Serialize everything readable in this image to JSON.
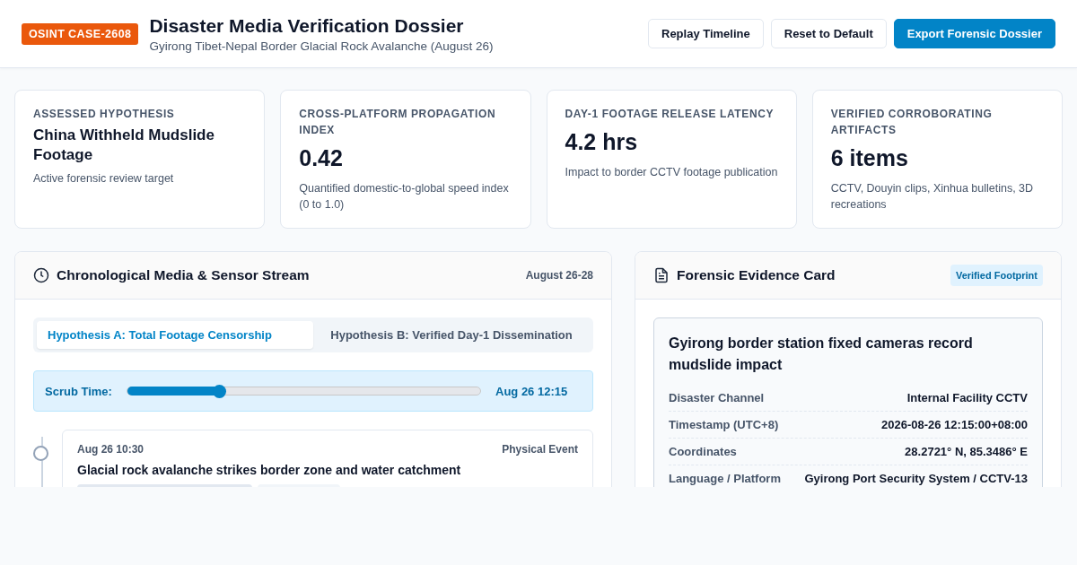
{
  "header": {
    "badge": "OSINT CASE-2608",
    "title": "Disaster Media Verification Dossier",
    "subtitle": "Gyirong Tibet-Nepal Border Glacial Rock Avalanche (August 26)",
    "buttons": [
      {
        "label": "Replay Timeline",
        "kind": "secondary"
      },
      {
        "label": "Reset to Default",
        "kind": "secondary"
      },
      {
        "label": "Export Forensic Dossier",
        "kind": "primary"
      }
    ]
  },
  "metrics": [
    {
      "label": "ASSESSED HYPOTHESIS",
      "value": "China Withheld Mudslide Footage",
      "kind": "text",
      "note": "Active forensic review target"
    },
    {
      "label": "CROSS-PLATFORM PROPAGATION INDEX",
      "value": "0.42",
      "kind": "number",
      "note": "Quantified domestic-to-global speed index (0 to 1.0)"
    },
    {
      "label": "DAY-1 FOOTAGE RELEASE LATENCY",
      "value": "4.2 hrs",
      "kind": "number",
      "note": "Impact to border CCTV footage publication"
    },
    {
      "label": "VERIFIED CORROBORATING ARTIFACTS",
      "value": "6 items",
      "kind": "number",
      "note": "CCTV, Douyin clips, Xinhua bulletins, 3D recreations"
    }
  ],
  "timeline_panel": {
    "title": "Chronological Media & Sensor Stream",
    "range": "August 26-28",
    "tabs": [
      {
        "label": "Hypothesis A: Total Footage Censorship",
        "selected": true
      },
      {
        "label": "Hypothesis B: Verified Day-1 Dissemination",
        "selected": false
      }
    ],
    "scrub": {
      "label": "Scrub Time:",
      "level": 0.26,
      "reading": "Aug 26 12:15"
    },
    "events": [
      {
        "time": "Aug 26 10:30",
        "type": "Physical Event",
        "title": "Glacial rock avalanche strikes border zone and water catchment"
      }
    ]
  },
  "evidence_panel": {
    "title": "Forensic Evidence Card",
    "badge": "Verified Footprint",
    "card": {
      "title": "Gyirong border station fixed cameras record mudslide impact",
      "fields": [
        {
          "label": "Disaster Channel",
          "value": "Internal Facility CCTV"
        },
        {
          "label": "Timestamp (UTC+8)",
          "value": "2026-08-26 12:15:00+08:00"
        },
        {
          "label": "Coordinates",
          "value": "28.2721° N, 85.3486° E"
        },
        {
          "label": "Language / Platform",
          "value": "Gyirong Port Security System / CCTV-13"
        }
      ]
    }
  }
}
